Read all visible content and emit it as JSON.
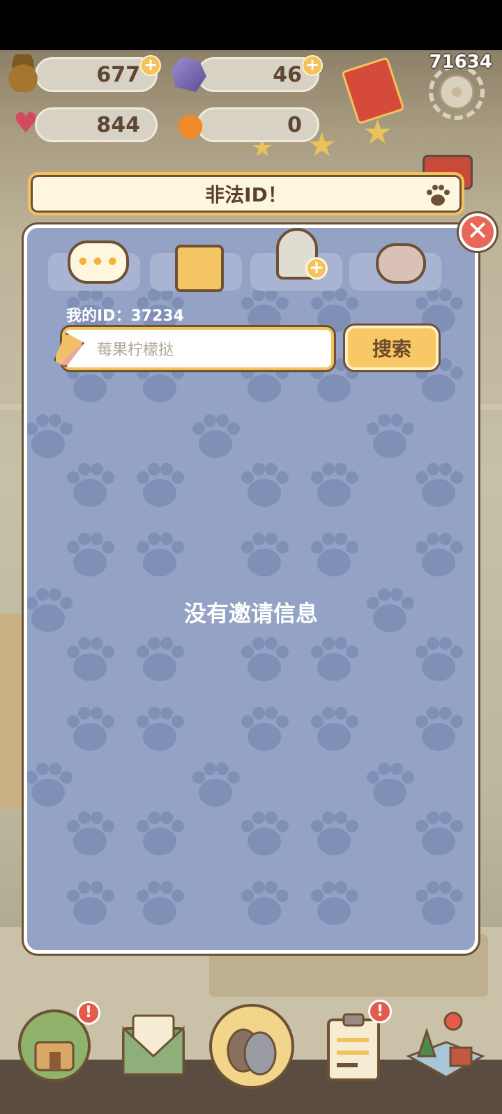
{
  "top_counter": "71634",
  "currencies": [
    {
      "name": "acorns",
      "value": "677",
      "icon": "acorn-icon",
      "has_plus": true
    },
    {
      "name": "crystals",
      "value": "46",
      "icon": "crystal-icon",
      "has_plus": true
    },
    {
      "name": "hearts",
      "value": "844",
      "icon": "heart-icon",
      "has_plus": false
    },
    {
      "name": "oranges",
      "value": "0",
      "icon": "orange-icon",
      "has_plus": false
    }
  ],
  "alert": {
    "text": "非法ID！",
    "icon": "paw-icon"
  },
  "panel": {
    "tabs": [
      {
        "name": "messages",
        "icon": "chat-bubble-icon",
        "selected": true
      },
      {
        "name": "friend-book",
        "icon": "notebook-icon",
        "selected": false
      },
      {
        "name": "add-friend",
        "icon": "add-friend-icon",
        "selected": false
      },
      {
        "name": "hug",
        "icon": "hug-icon",
        "selected": false
      }
    ],
    "my_id_label": "我的ID：37234",
    "search": {
      "placeholder": "莓果柠檬挞",
      "button": "搜索"
    },
    "empty_text": "没有邀请信息"
  },
  "close_glyph": "✕",
  "plus_glyph": "+",
  "badge_glyph": "!",
  "chat_dots": "•••",
  "bottom_nav": [
    {
      "name": "home",
      "icon": "house-icon",
      "badge": true
    },
    {
      "name": "mail",
      "icon": "mail-icon",
      "badge": false
    },
    {
      "name": "friends",
      "icon": "friends-icon",
      "badge": false,
      "active": true
    },
    {
      "name": "tasks",
      "icon": "clipboard-icon",
      "badge": true
    },
    {
      "name": "map",
      "icon": "map-icon",
      "badge": false
    }
  ],
  "colors": {
    "panel": "#94a3c5",
    "accent": "#f2c35a",
    "outline": "#6d5135",
    "close": "#e7675a"
  }
}
